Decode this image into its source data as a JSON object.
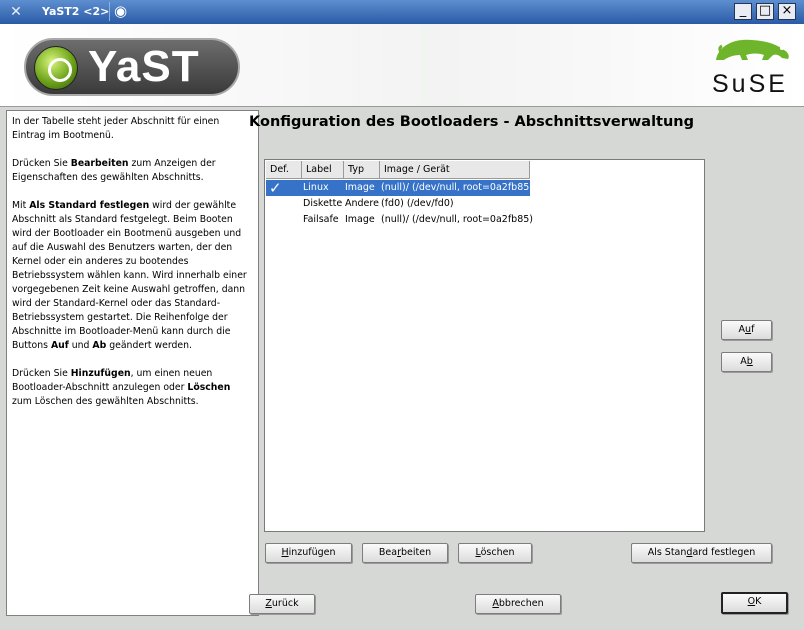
{
  "window": {
    "title": "YaST2 <2>",
    "controls": {
      "minimize": "_",
      "maximize": "□",
      "close": "×"
    }
  },
  "banner": {
    "logo_text": "YaST",
    "brand_text": "SuSE"
  },
  "help": {
    "p1": "In der Tabelle steht jeder Abschnitt für einen Eintrag im Bootmenü.",
    "p2a": "Drücken Sie ",
    "p2b": "Bearbeiten",
    "p2c": " zum Anzeigen der Eigenschaften des gewählten Abschnitts.",
    "p3a": "Mit ",
    "p3b": "Als Standard festlegen",
    "p3c": " wird der gewählte Abschnitt als Standard festgelegt. Beim Booten wird der Bootloader ein Bootmenü ausgeben und auf die Auswahl des Benutzers warten, der den Kernel oder ein anderes zu bootendes Betriebssystem wählen kann. Wird innerhalb einer vorgegebenen Zeit keine Auswahl getroffen, dann wird der Standard-Kernel oder das Standard-Betriebssystem gestartet. Die Reihenfolge der Abschnitte im Bootloader-Menü kann durch die Buttons ",
    "p3d": "Auf",
    "p3e": " und ",
    "p3f": "Ab",
    "p3g": " geändert werden.",
    "p4a": "Drücken Sie ",
    "p4b": "Hinzufügen",
    "p4c": ", um einen neuen Bootloader-Abschnitt anzulegen oder ",
    "p4d": "Löschen",
    "p4e": " zum Löschen des gewählten Abschnitts."
  },
  "main": {
    "heading": "Konfiguration des Bootloaders - Abschnittsverwaltung"
  },
  "table": {
    "headers": [
      "Def.",
      "Label",
      "Typ",
      "Image / Gerät"
    ],
    "rows": [
      {
        "def": "✓",
        "label": "Linux",
        "type": "Image",
        "image": "(null)/   (/dev/null, root=0a2fb85)",
        "selected": true
      },
      {
        "def": "",
        "label": "Diskette",
        "type": "Andere",
        "image": "(fd0)   (/dev/fd0)",
        "selected": false
      },
      {
        "def": "",
        "label": "Failsafe",
        "type": "Image",
        "image": "(null)/   (/dev/null, root=0a2fb85)",
        "selected": false
      }
    ]
  },
  "buttons": {
    "up": {
      "pre": "A",
      "u": "u",
      "post": "f"
    },
    "down": {
      "pre": "A",
      "u": "b",
      "post": ""
    },
    "add": {
      "pre": "",
      "u": "H",
      "post": "inzufügen"
    },
    "edit": {
      "pre": "Bea",
      "u": "r",
      "post": "beiten"
    },
    "delete": {
      "pre": "",
      "u": "L",
      "post": "öschen"
    },
    "set_default": {
      "pre": "Als Stan",
      "u": "d",
      "post": "ard festlegen"
    },
    "back": {
      "pre": "",
      "u": "Z",
      "post": "urück"
    },
    "abort": {
      "pre": "",
      "u": "A",
      "post": "bbrechen"
    },
    "ok": {
      "pre": "",
      "u": "O",
      "post": "K"
    }
  },
  "colors": {
    "selection": "#3673c8",
    "titlebar": "#2a5aa6",
    "window_bg": "#d6d8d6"
  }
}
